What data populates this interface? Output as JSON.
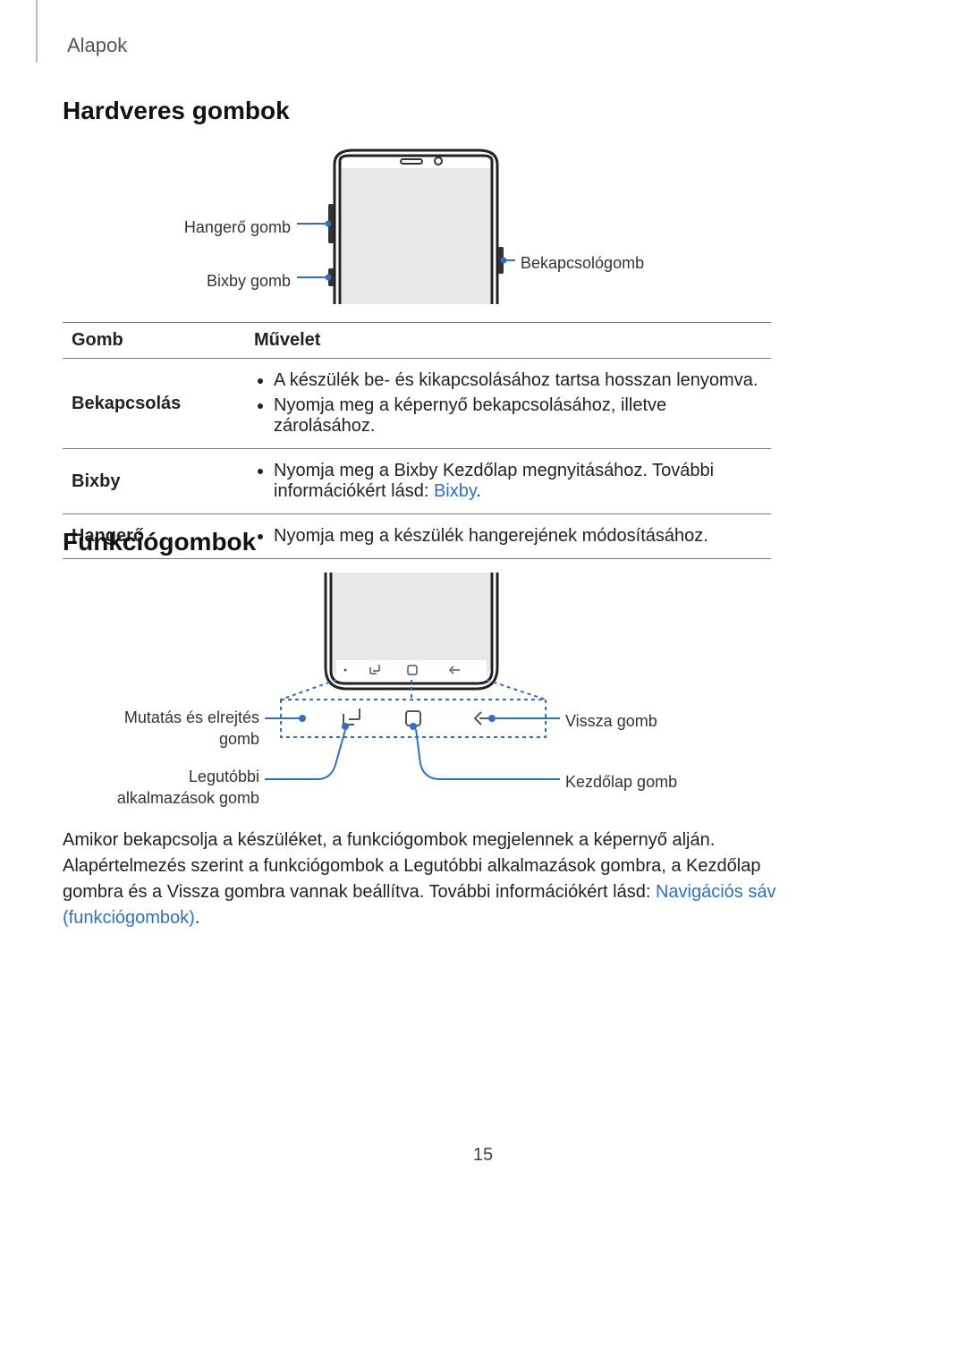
{
  "breadcrumb": "Alapok",
  "heading1": "Hardveres gombok",
  "heading2": "Funkciógombok",
  "fig1_labels": {
    "vol": "Hangerő gomb",
    "bixby": "Bixby gomb",
    "power": "Bekapcsológomb"
  },
  "table": {
    "header": {
      "col1": "Gomb",
      "col2": "Művelet"
    },
    "rows": {
      "power": {
        "name": "Bekapcsolás",
        "item1": "A készülék be- és kikapcsolásához tartsa hosszan lenyomva.",
        "item2": "Nyomja meg a képernyő bekapcsolásához, illetve zárolásához."
      },
      "bixby": {
        "name": "Bixby",
        "item_pre": "Nyomja meg a Bixby Kezdőlap megnyitásához. További információkért lásd: ",
        "item_link": "Bixby",
        "item_post": "."
      },
      "volume": {
        "name": "Hangerő",
        "item1": "Nyomja meg a készülék hangerejének módosításához."
      }
    }
  },
  "fig2_labels": {
    "show_hide_l1": "Mutatás és elrejtés",
    "show_hide_l2": "gomb",
    "recents_l1": "Legutóbbi",
    "recents_l2": "alkalmazások gomb",
    "back": "Vissza gomb",
    "home": "Kezdőlap gomb"
  },
  "body": {
    "pre": "Amikor bekapcsolja a készüléket, a funkciógombok megjelennek a képernyő alján. Alapértelmezés szerint a funkciógombok a Legutóbbi alkalmazások gombra, a Kezdőlap gombra és a Vissza gombra vannak beállítva. További információkért lásd: ",
    "link": "Navigációs sáv (funkciógombok)",
    "post": "."
  },
  "page_number": "15"
}
